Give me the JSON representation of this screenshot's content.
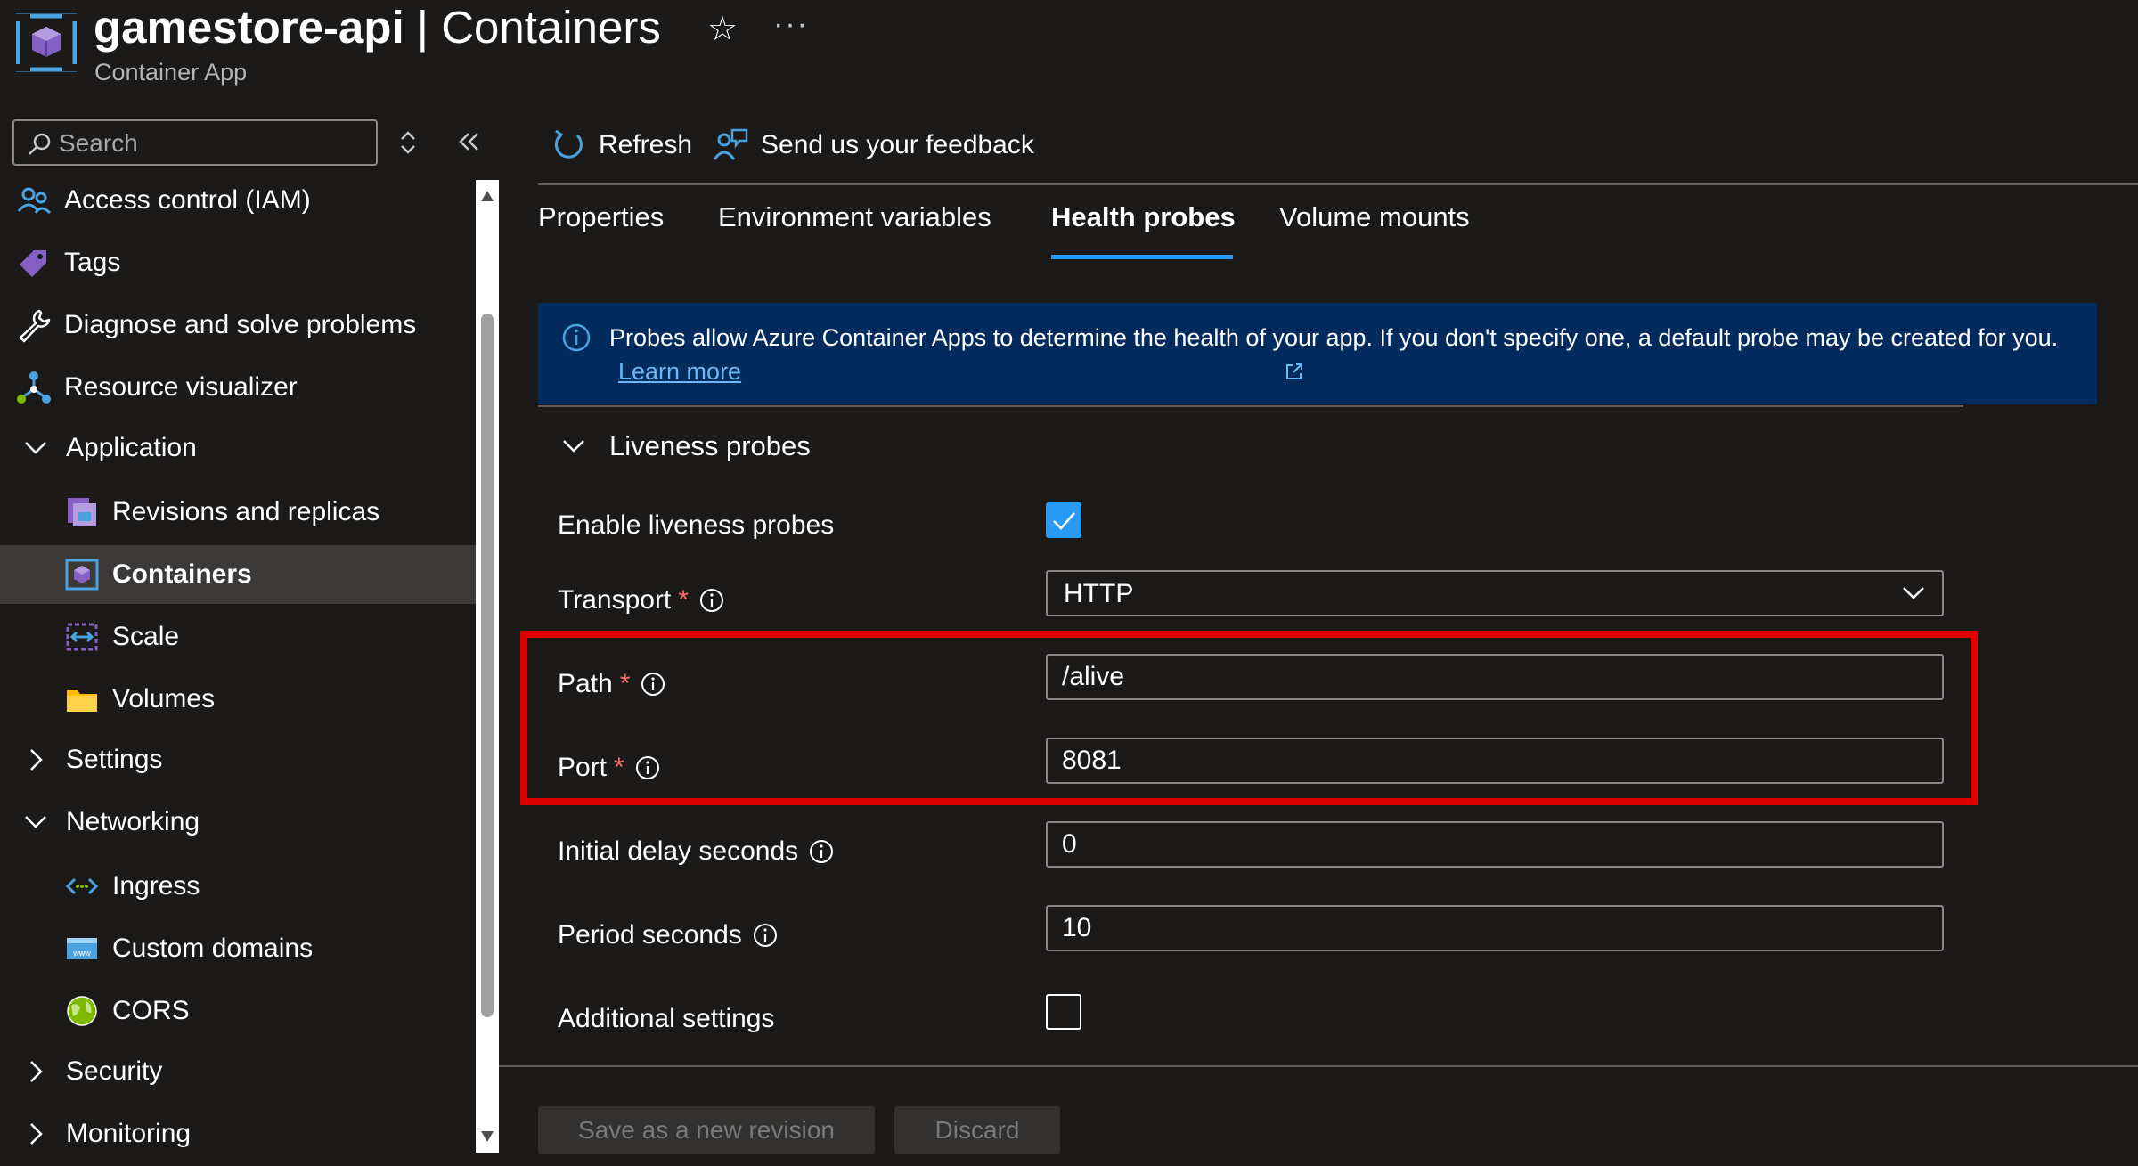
{
  "header": {
    "resource_name": "gamestore-api",
    "separator": " | ",
    "page_name": "Containers",
    "subtitle": "Container App",
    "star_icon": "☆",
    "more_icon": "···"
  },
  "sidebar": {
    "search_placeholder": "Search",
    "items": {
      "access_control": "Access control (IAM)",
      "tags": "Tags",
      "diagnose": "Diagnose and solve problems",
      "resource_visualizer": "Resource visualizer",
      "application": "Application",
      "revisions": "Revisions and replicas",
      "containers": "Containers",
      "scale": "Scale",
      "volumes": "Volumes",
      "settings": "Settings",
      "networking": "Networking",
      "ingress": "Ingress",
      "custom_domains": "Custom domains",
      "cors": "CORS",
      "security": "Security",
      "monitoring": "Monitoring"
    },
    "selected_item": "Containers"
  },
  "toolbar": {
    "refresh_label": "Refresh",
    "feedback_label": "Send us your feedback"
  },
  "tabs": {
    "properties": "Properties",
    "env_vars": "Environment variables",
    "health_probes": "Health probes",
    "volume_mounts": "Volume mounts",
    "active": "Health probes"
  },
  "banner": {
    "message": "Probes allow Azure Container Apps to determine the health of your app. If you don't specify one, a default probe may be created for you.",
    "link_label": "Learn more"
  },
  "liveness": {
    "section_title": "Liveness probes",
    "enable_label": "Enable liveness probes",
    "enable_checked": true,
    "transport_label": "Transport",
    "transport_value": "HTTP",
    "path_label": "Path",
    "path_value": "/alive",
    "port_label": "Port",
    "port_value": "8081",
    "initial_delay_label": "Initial delay seconds",
    "initial_delay_value": "0",
    "period_label": "Period seconds",
    "period_value": "10",
    "additional_label": "Additional settings",
    "additional_checked": false,
    "required_mark": "*"
  },
  "footer": {
    "save_label": "Save as a new revision",
    "discard_label": "Discard"
  },
  "colors": {
    "background": "#1b1a19",
    "accent": "#2899f5",
    "banner_bg": "#032b5e",
    "highlight": "#e00000",
    "required": "#ff6b6b"
  }
}
